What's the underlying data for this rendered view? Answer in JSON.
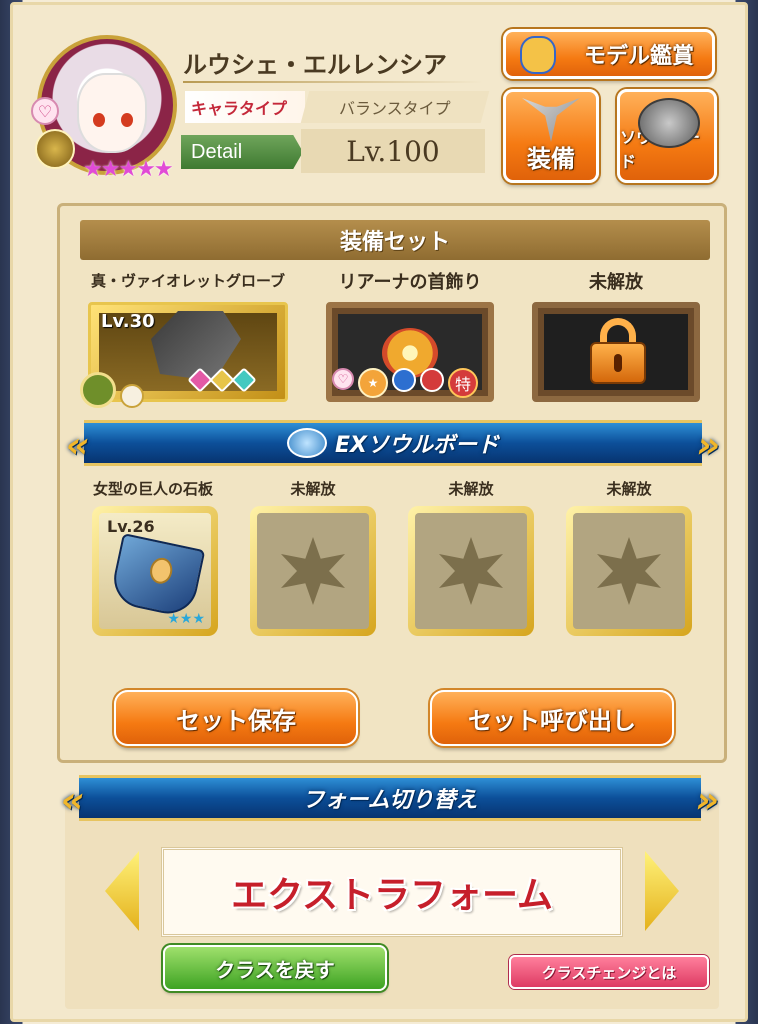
{
  "character": {
    "name": "ルウシェ・エルレンシア",
    "type_label": "キャラタイプ",
    "type_value": "バランスタイプ",
    "detail_label": "Detail",
    "level": "Lv.100",
    "stars": "★★★★★",
    "rarity_stars": 5,
    "affection_icon": "♡"
  },
  "top_buttons": {
    "model_view": "モデル鑑賞",
    "equip": "装備",
    "soul_board": "ソウルボード"
  },
  "equipment_set": {
    "title": "装備セット",
    "slots": [
      {
        "name": "真・ヴァイオレットグローブ",
        "level": "Lv.30",
        "icon": "violet-glove-icon",
        "state": "equipped"
      },
      {
        "name": "リアーナの首飾り",
        "icon": "riana-necklace-icon",
        "state": "equipped",
        "badge": "特",
        "affection_icon": "♡"
      },
      {
        "name": "未解放",
        "icon": "lock-icon",
        "state": "locked"
      }
    ]
  },
  "ex_soul_board": {
    "title": "EXソウルボード",
    "slots": [
      {
        "name": "女型の巨人の石板",
        "level": "Lv.26",
        "stars": "★★★",
        "icon": "stone-tablet-icon",
        "state": "equipped"
      },
      {
        "name": "未解放",
        "icon": "star-placeholder-icon",
        "state": "locked"
      },
      {
        "name": "未解放",
        "icon": "star-placeholder-icon",
        "state": "locked"
      },
      {
        "name": "未解放",
        "icon": "star-placeholder-icon",
        "state": "locked"
      }
    ],
    "save_button": "セット保存",
    "load_button": "セット呼び出し"
  },
  "form_switch": {
    "title": "フォーム切り替え",
    "current_form": "エクストラフォーム",
    "revert_class_button": "クラスを戻す",
    "class_change_info_button": "クラスチェンジとは"
  },
  "colors": {
    "accent_orange": "#f57a12",
    "banner_blue": "#0c4f99",
    "form_red": "#c61f2b",
    "panel_beige": "#f3e8cc"
  }
}
